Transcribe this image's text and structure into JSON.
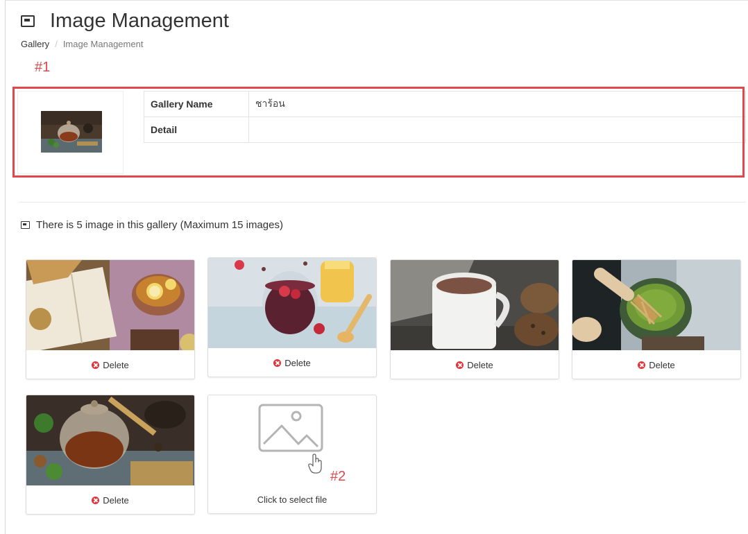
{
  "page": {
    "title": "Image Management"
  },
  "breadcrumb": {
    "items": [
      "Gallery",
      "/",
      "Image Management"
    ]
  },
  "annotations": {
    "a1": "#1",
    "a2": "#2"
  },
  "gallery_info": {
    "rows": [
      {
        "label": "Gallery Name",
        "value": "ชาร้อน"
      },
      {
        "label": "Detail",
        "value": ""
      }
    ]
  },
  "images_section": {
    "summary": "There is 5 image in this gallery (Maximum 15 images)",
    "delete_label": "Delete",
    "upload_label": "Click to select file",
    "images": [
      {
        "name": "tea-book-lemon-photo"
      },
      {
        "name": "red-tea-honey-photo"
      },
      {
        "name": "hot-chocolate-mug-photo"
      },
      {
        "name": "matcha-whisk-photo"
      },
      {
        "name": "teapot-herbs-photo"
      }
    ]
  },
  "colors": {
    "annotation_red": "#e2474c",
    "delete_red": "#e2343b",
    "text": "#333333",
    "muted": "#777777",
    "border": "#dddddd"
  }
}
